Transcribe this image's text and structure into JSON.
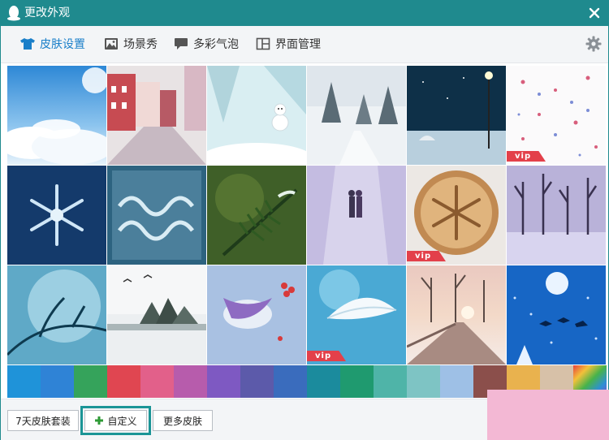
{
  "window": {
    "title": "更改外观"
  },
  "tabs": [
    {
      "label": "皮肤设置",
      "icon": "shirt-icon"
    },
    {
      "label": "场景秀",
      "icon": "image-icon"
    },
    {
      "label": "多彩气泡",
      "icon": "chat-bubble-icon"
    },
    {
      "label": "界面管理",
      "icon": "layout-icon"
    }
  ],
  "active_tab": "皮肤设置",
  "skins": [
    {
      "theme": "clouds-sky"
    },
    {
      "theme": "snowy-street"
    },
    {
      "theme": "snowman"
    },
    {
      "theme": "snow-forest-path"
    },
    {
      "theme": "night-lamp-umbrella"
    },
    {
      "theme": "snowflake-pattern",
      "vip": "vip"
    },
    {
      "theme": "ice-snowflake"
    },
    {
      "theme": "merry-christmas-frost"
    },
    {
      "theme": "pine-branch"
    },
    {
      "theme": "couple-snow-walk"
    },
    {
      "theme": "latte-snowflake",
      "vip": "vip"
    },
    {
      "theme": "purple-trees"
    },
    {
      "theme": "icy-branch-blue"
    },
    {
      "theme": "winter-lake-birds"
    },
    {
      "theme": "bird-berries"
    },
    {
      "theme": "feather",
      "vip": "vip"
    },
    {
      "theme": "sunset-boardwalk"
    },
    {
      "theme": "moon-reindeer"
    }
  ],
  "colors": [
    "#1f93d9",
    "#2f83d6",
    "#35a35b",
    "#e04651",
    "#e2608a",
    "#b75cac",
    "#7e59c2",
    "#5c5aaa",
    "#3a6cbd",
    "#1b8b9d",
    "#1f9a6f",
    "#4fb4a8",
    "#7ec4c4",
    "#9ec0e6",
    "#8b4f4b",
    "#e9b24e",
    "#d7c1a8",
    "rainbow"
  ],
  "buttons": {
    "trial": "7天皮肤套装",
    "custom": "自定义",
    "more": "更多皮肤"
  },
  "accent": "#1f8a8e"
}
